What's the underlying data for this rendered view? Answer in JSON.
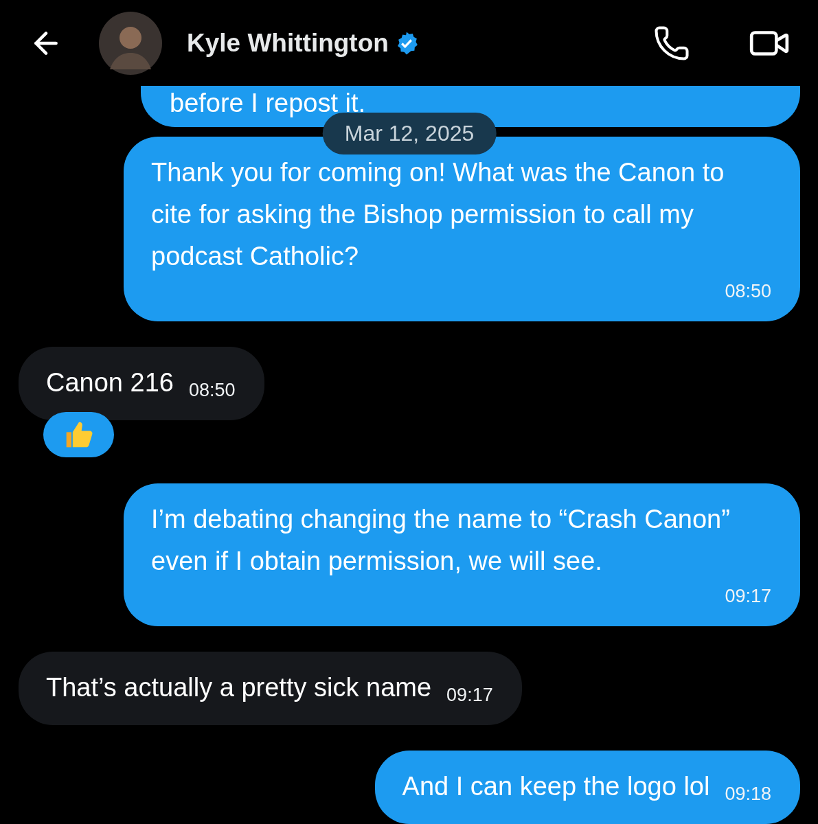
{
  "header": {
    "name": "Kyle Whittington",
    "verified": true
  },
  "messages": [
    {
      "kind": "sent",
      "text": "before I repost it."
    },
    {
      "kind": "date",
      "text": "Mar 12, 2025"
    },
    {
      "kind": "sent",
      "text": "Thank you for coming on! What was the Canon to cite for asking the Bishop permission to call my podcast Catholic?",
      "time": "08:50"
    },
    {
      "kind": "received",
      "text": "Canon 216",
      "time": "08:50",
      "reaction": {
        "kind": "thumbs_up"
      }
    },
    {
      "kind": "sent",
      "text": "I’m debating changing the name to “Crash Canon” even if I obtain permission, we will see.",
      "time": "09:17"
    },
    {
      "kind": "received",
      "text": "That’s actually a pretty sick name",
      "time": "09:17"
    },
    {
      "kind": "sent",
      "text": "And I can keep the logo lol",
      "time": "09:18"
    }
  ]
}
